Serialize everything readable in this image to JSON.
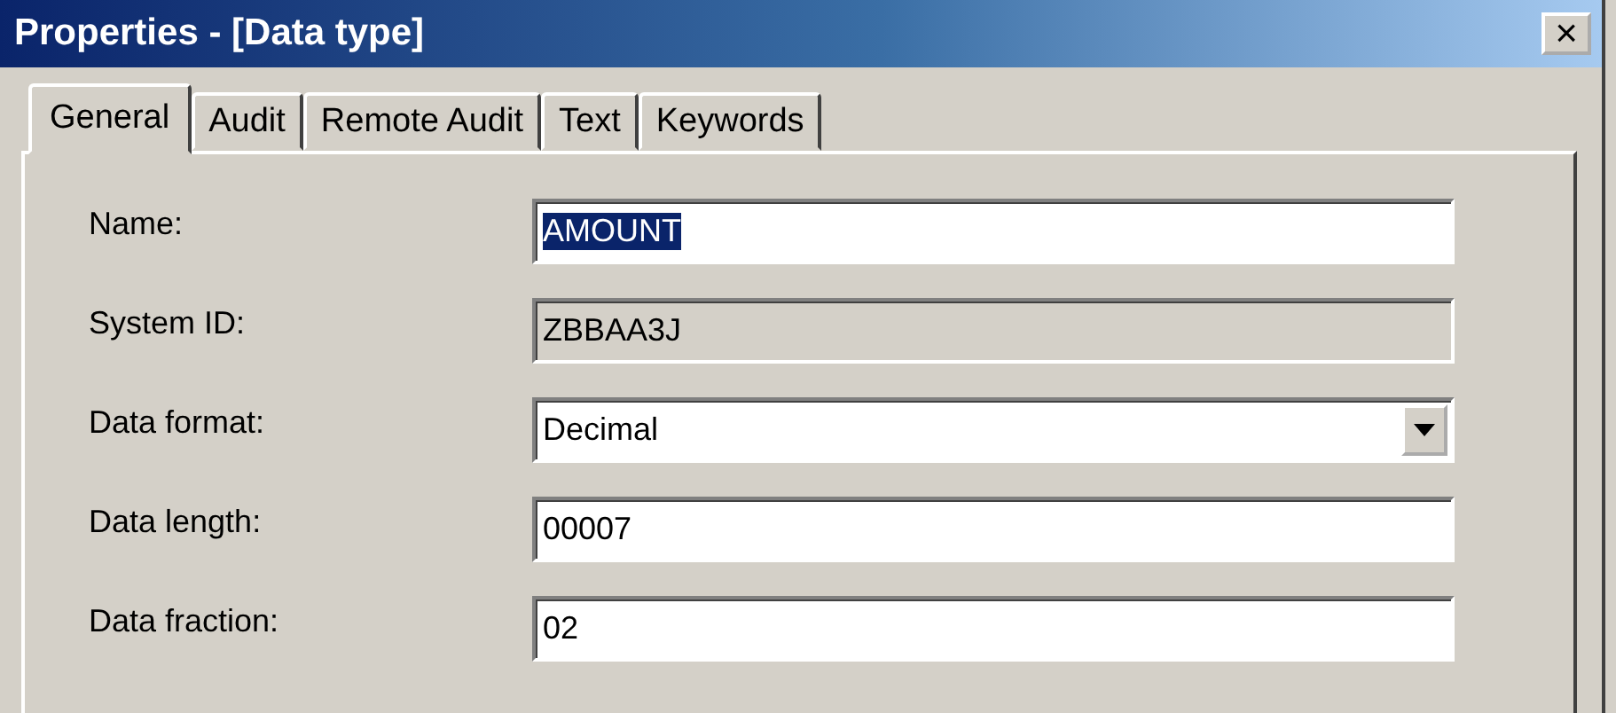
{
  "window": {
    "title": "Properties - [Data type]",
    "close": "×"
  },
  "tabs": [
    {
      "label": "General",
      "selected": true
    },
    {
      "label": "Audit",
      "selected": false
    },
    {
      "label": "Remote Audit",
      "selected": false
    },
    {
      "label": "Text",
      "selected": false
    },
    {
      "label": "Keywords",
      "selected": false
    }
  ],
  "fields": [
    {
      "label": "Name:",
      "kind": "text",
      "value": "AMOUNT",
      "disabled": false,
      "text_selected": true
    },
    {
      "label": "System ID:",
      "kind": "text",
      "value": "ZBBAA3J",
      "disabled": true,
      "text_selected": false
    },
    {
      "label": "Data format:",
      "kind": "dropdown",
      "value": "Decimal",
      "disabled": false,
      "text_selected": false
    },
    {
      "label": "Data length:",
      "kind": "text",
      "value": "00007",
      "disabled": false,
      "text_selected": false
    },
    {
      "label": "Data fraction:",
      "kind": "text",
      "value": "02",
      "disabled": false,
      "text_selected": false
    }
  ]
}
